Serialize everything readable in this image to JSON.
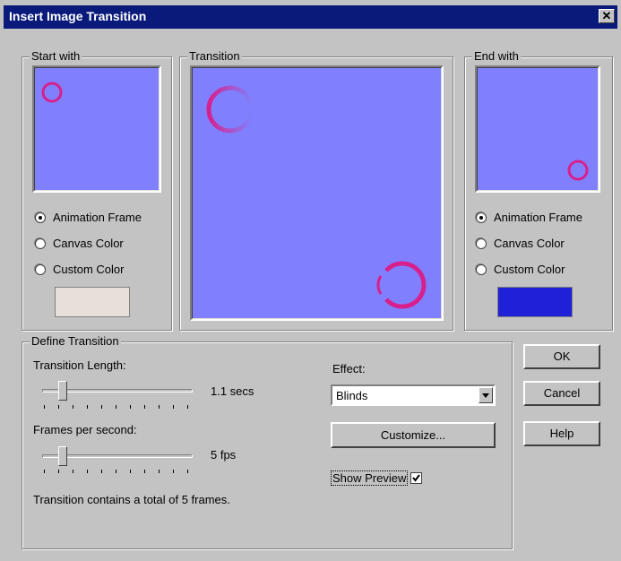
{
  "title": "Insert Image Transition",
  "close_label": "✕",
  "start_with": {
    "legend": "Start with",
    "options": [
      "Animation Frame",
      "Canvas Color",
      "Custom Color"
    ],
    "selected": 0,
    "custom_color": "#e8e0d8"
  },
  "transition": {
    "legend": "Transition"
  },
  "end_with": {
    "legend": "End with",
    "options": [
      "Animation Frame",
      "Canvas Color",
      "Custom Color"
    ],
    "selected": 0,
    "custom_color": "#2020d8"
  },
  "define": {
    "legend": "Define Transition",
    "length_label": "Transition Length:",
    "length_value": "1.1 secs",
    "fps_label": "Frames per second:",
    "fps_value": "5 fps",
    "summary": "Transition contains a total of 5 frames.",
    "effect_label": "Effect:",
    "effect_value": "Blinds",
    "customize_label": "Customize...",
    "show_preview_label": "Show Preview",
    "show_preview_checked": true
  },
  "buttons": {
    "ok": "OK",
    "cancel": "Cancel",
    "help": "Help"
  },
  "colors": {
    "preview_bg": "#8080ff",
    "ring": "#d8208c",
    "title_bar": "#0a1a7a"
  }
}
